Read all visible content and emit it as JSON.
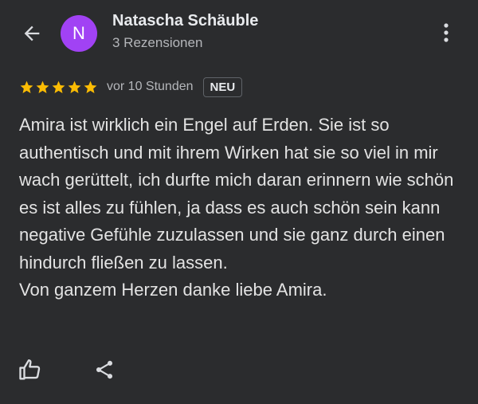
{
  "header": {
    "avatar_letter": "N",
    "avatar_color": "#a142f4",
    "author_name": "Natascha Schäuble",
    "review_count": "3 Rezensionen",
    "back_icon": "arrow-left-icon",
    "more_icon": "more-vert-icon"
  },
  "review": {
    "rating": 5,
    "max_rating": 5,
    "star_color": "#fbbc04",
    "time": "vor 10 Stunden",
    "badge": "NEU",
    "paragraphs": [
      "Amira ist wirklich ein Engel auf Erden. Sie ist so authentisch und mit ihrem Wirken hat sie so viel in mir wach gerüttelt, ich durfte mich daran erinnern wie schön es ist alles zu fühlen, ja dass es auch schön sein kann negative Gefühle zuzulassen und sie ganz durch einen hindurch fließen zu lassen.",
      "Von ganzem Herzen danke liebe Amira."
    ]
  },
  "actions": {
    "like_icon": "thumb-up-icon",
    "share_icon": "share-icon"
  }
}
